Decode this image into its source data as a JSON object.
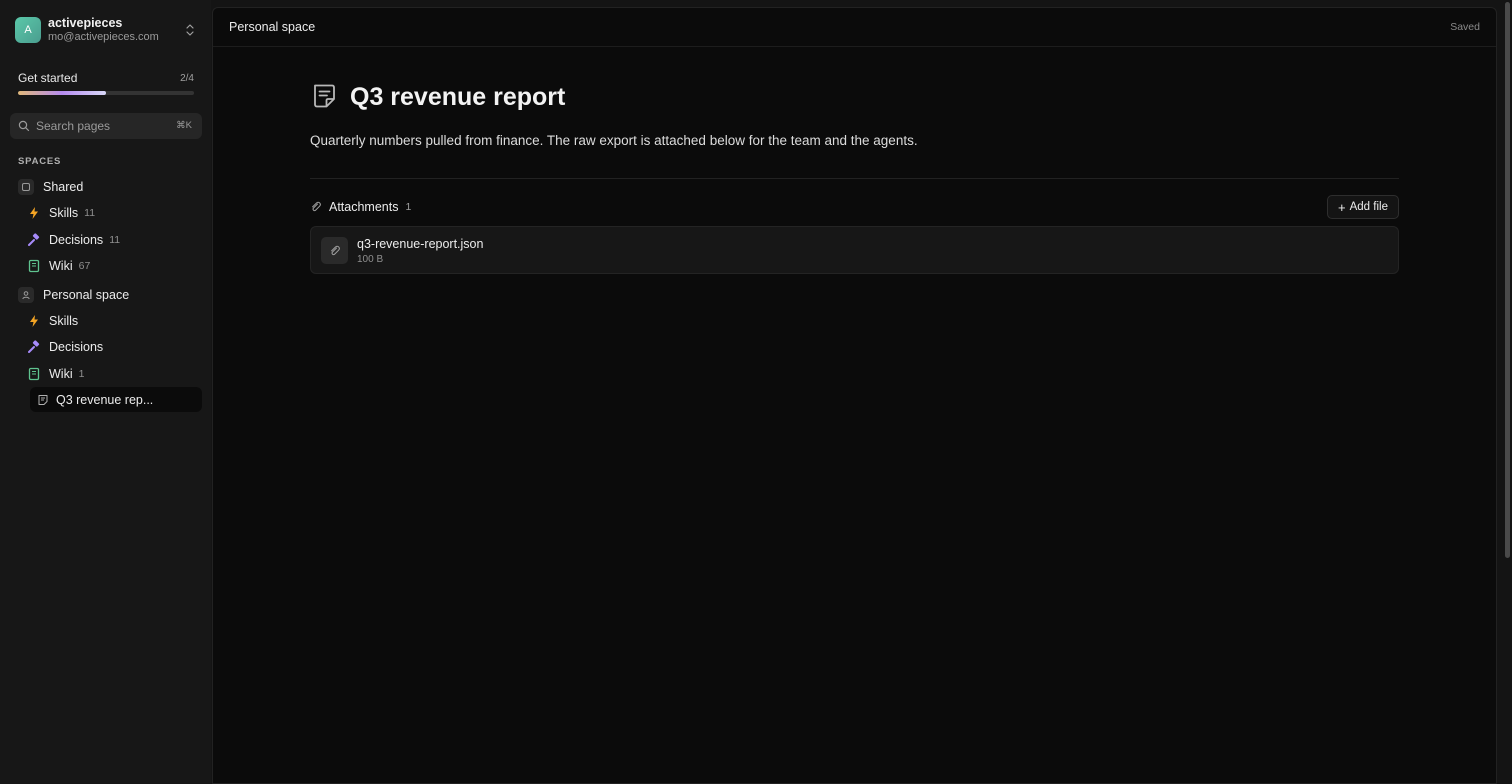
{
  "workspace": {
    "avatar_letter": "A",
    "name": "activepieces",
    "email": "mo@activepieces.com"
  },
  "get_started": {
    "label": "Get started",
    "count": "2/4",
    "progress_fraction": 0.5
  },
  "search": {
    "placeholder": "Search pages",
    "shortcut": "⌘K"
  },
  "spaces": {
    "heading": "SPACES",
    "shared": {
      "label": "Shared",
      "items": [
        {
          "label": "Skills",
          "count": "11"
        },
        {
          "label": "Decisions",
          "count": "11"
        },
        {
          "label": "Wiki",
          "count": "67"
        }
      ]
    },
    "personal": {
      "label": "Personal space",
      "items": [
        {
          "label": "Skills",
          "count": ""
        },
        {
          "label": "Decisions",
          "count": ""
        },
        {
          "label": "Wiki",
          "count": "1"
        }
      ],
      "page": "Q3 revenue rep..."
    }
  },
  "topbar": {
    "breadcrumb": "Personal space",
    "status": "Saved"
  },
  "document": {
    "title": "Q3 revenue report",
    "description": "Quarterly numbers pulled from finance. The raw export is attached below for the team and the agents."
  },
  "attachments": {
    "label": "Attachments",
    "count": "1",
    "add_label": "Add file",
    "files": [
      {
        "name": "q3-revenue-report.json",
        "size": "100 B"
      }
    ]
  },
  "colors": {
    "accent_skills": "#f5a524",
    "accent_decisions": "#a78bfa",
    "accent_wiki": "#5fc38f"
  }
}
